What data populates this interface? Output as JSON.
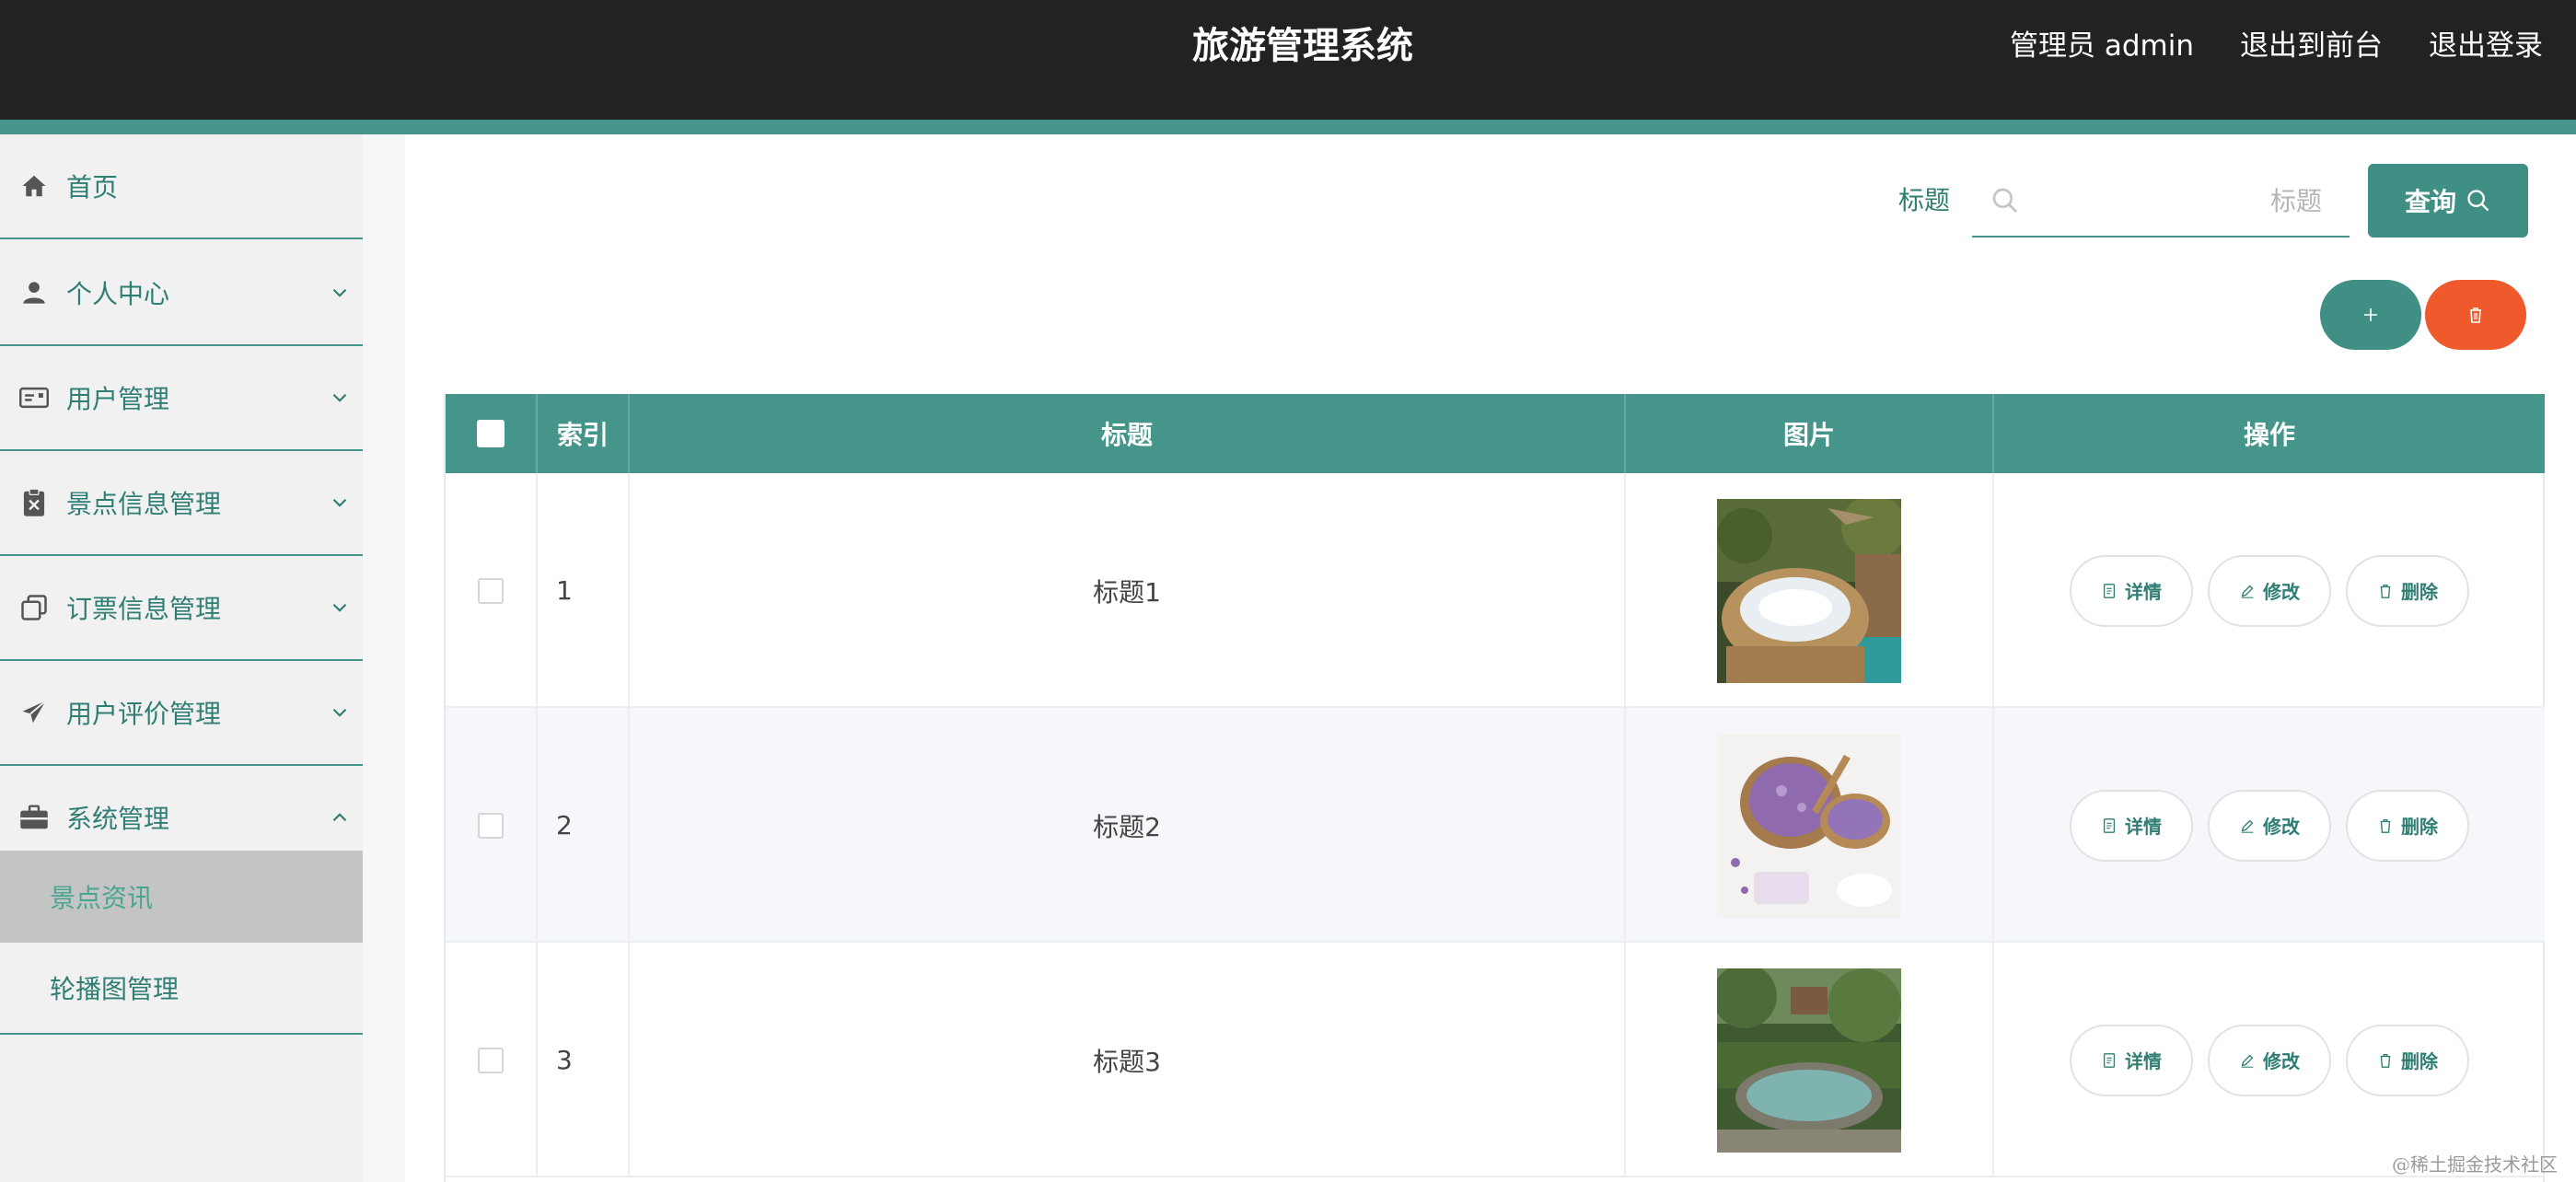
{
  "header": {
    "title": "旅游管理系统",
    "user": "管理员 admin",
    "to_front": "退出到前台",
    "logout": "退出登录"
  },
  "sidebar": {
    "items": [
      {
        "label": "首页",
        "icon": "home-icon",
        "has_children": false
      },
      {
        "label": "个人中心",
        "icon": "person-icon",
        "has_children": true,
        "expanded": false
      },
      {
        "label": "用户管理",
        "icon": "id-card-icon",
        "has_children": true,
        "expanded": false
      },
      {
        "label": "景点信息管理",
        "icon": "clipboard-x-icon",
        "has_children": true,
        "expanded": false
      },
      {
        "label": "订票信息管理",
        "icon": "copy-icon",
        "has_children": true,
        "expanded": false
      },
      {
        "label": "用户评价管理",
        "icon": "send-icon",
        "has_children": true,
        "expanded": false
      },
      {
        "label": "系统管理",
        "icon": "briefcase-icon",
        "has_children": true,
        "expanded": true
      }
    ],
    "sub_items": [
      {
        "label": "景点资讯",
        "active": true
      },
      {
        "label": "轮播图管理",
        "active": false
      }
    ]
  },
  "search": {
    "label": "标题",
    "placeholder": "标题",
    "value": "",
    "button": "查询"
  },
  "table": {
    "headers": [
      "索引",
      "标题",
      "图片",
      "操作"
    ],
    "rows": [
      {
        "index": "1",
        "title": "标题1",
        "image": "hot-spring-pool-photo"
      },
      {
        "index": "2",
        "title": "标题2",
        "image": "lavender-spa-photo"
      },
      {
        "index": "3",
        "title": "标题3",
        "image": "garden-pool-photo"
      }
    ],
    "actions": {
      "detail": "详情",
      "edit": "修改",
      "delete": "删除"
    }
  },
  "colors": {
    "accent": "#45958a",
    "header_bg": "#222222",
    "danger": "#ef5a2d"
  },
  "watermark": "@稀土掘金技术社区"
}
